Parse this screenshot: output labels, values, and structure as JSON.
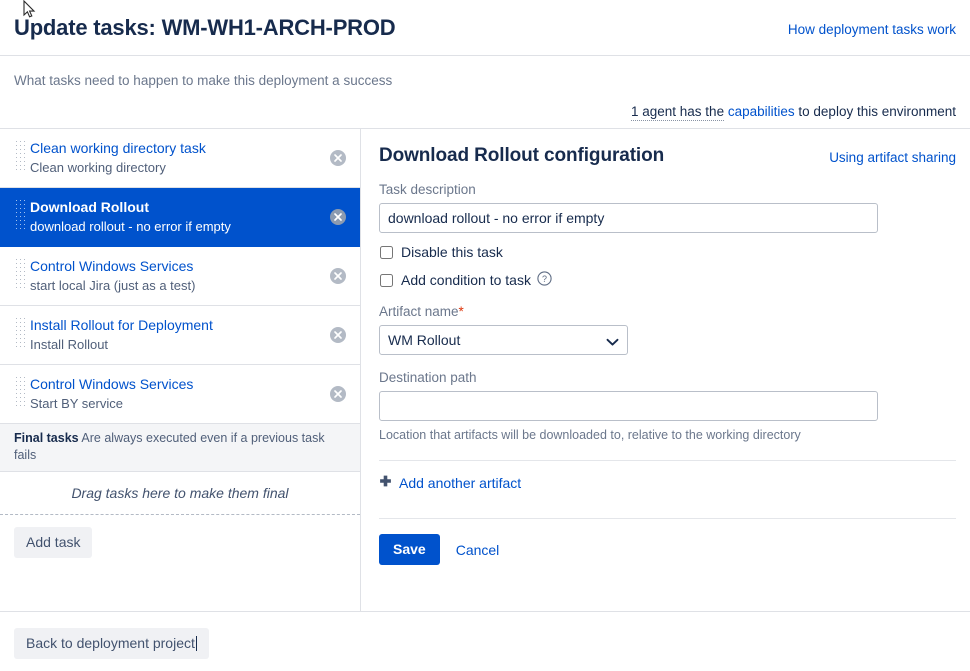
{
  "header": {
    "title": "Update tasks: WM-WH1-ARCH-PROD",
    "help_link": "How deployment tasks work",
    "subtitle": "What tasks need to happen to make this deployment a success",
    "agent_prefix": "1 agent has the",
    "agent_link": "capabilities",
    "agent_suffix": "to deploy this environment"
  },
  "task_list": {
    "items": [
      {
        "name": "Clean working directory task",
        "description": "Clean working directory",
        "selected": false
      },
      {
        "name": "Download Rollout",
        "description": "download rollout - no error if empty",
        "selected": true
      },
      {
        "name": "Control Windows Services",
        "description": "start local Jira (just as a test)",
        "selected": false
      },
      {
        "name": "Install Rollout for Deployment",
        "description": "Install Rollout",
        "selected": false
      },
      {
        "name": "Control Windows Services",
        "description": "Start BY service",
        "selected": false
      }
    ],
    "final_tasks_label": "Final tasks",
    "final_tasks_text": "Are always executed even if a previous task fails",
    "drop_zone_text": "Drag tasks here to make them final",
    "add_task_label": "Add task"
  },
  "config": {
    "title": "Download Rollout configuration",
    "head_link": "Using artifact sharing",
    "task_description_label": "Task description",
    "task_description_value": "download rollout - no error if empty",
    "disable_task_label": "Disable this task",
    "add_condition_label": "Add condition to task",
    "artifact_name_label": "Artifact name",
    "artifact_required_mark": "*",
    "artifact_name_value": "WM Rollout",
    "artifact_options": [
      "WM Rollout"
    ],
    "destination_path_label": "Destination path",
    "destination_path_value": "",
    "destination_hint": "Location that artifacts will be downloaded to, relative to the working directory",
    "add_another_artifact": "Add another artifact",
    "save_label": "Save",
    "cancel_label": "Cancel"
  },
  "footer": {
    "back_label": "Back to deployment project"
  },
  "colors": {
    "accent": "#0052CC",
    "link": "#0052CC",
    "selected_row": "#0052CC",
    "required": "#DE350B",
    "border": "#DFE1E6",
    "muted_text": "#6B778C"
  }
}
